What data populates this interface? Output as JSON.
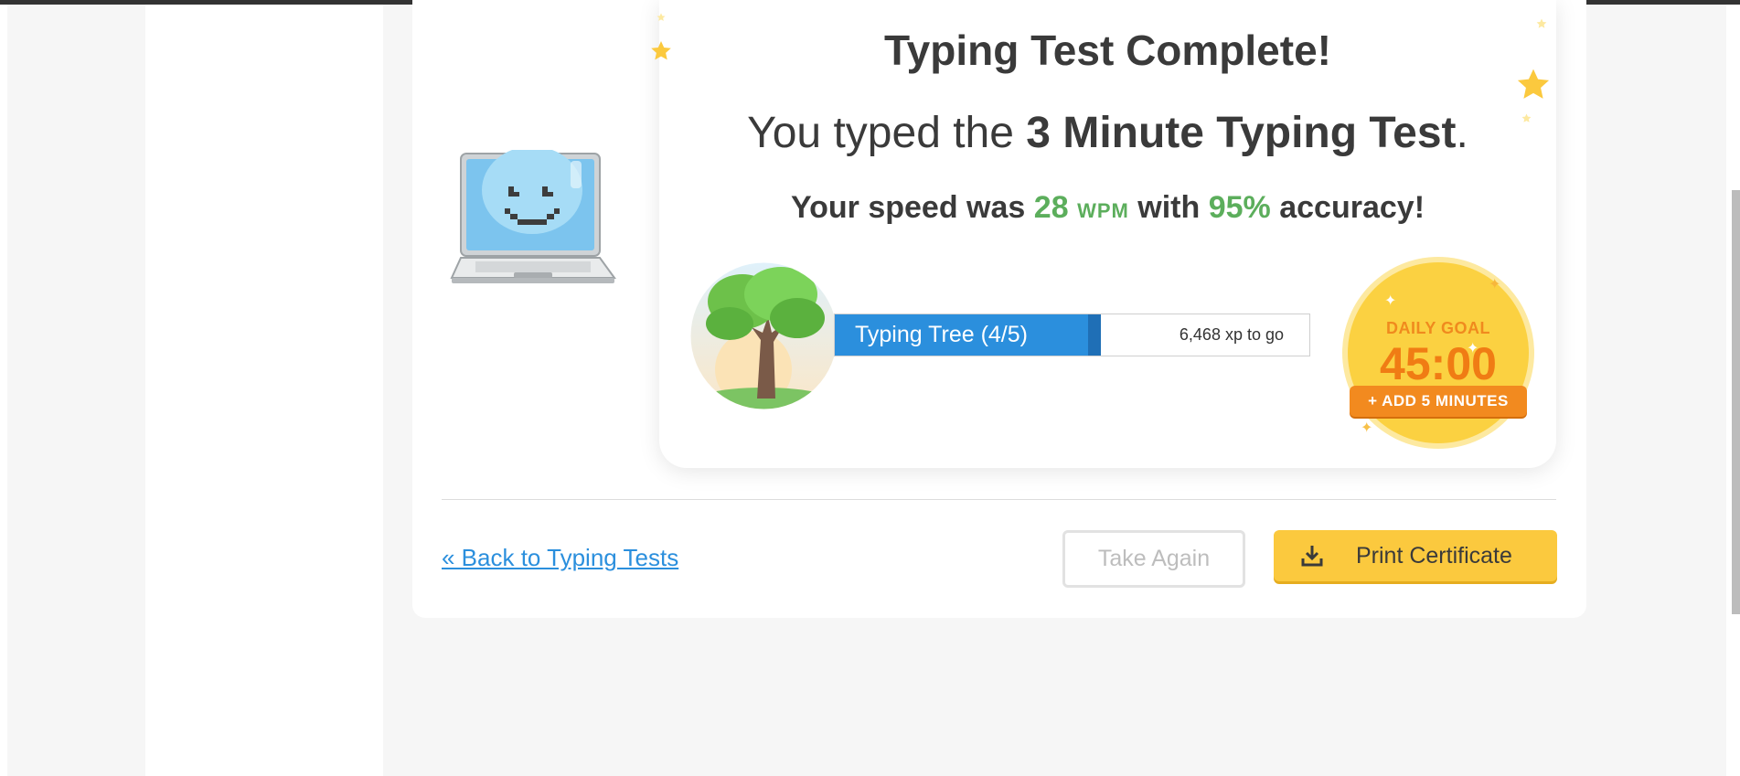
{
  "result": {
    "title": "Typing Test Complete!",
    "subtitle_prefix": "You typed the",
    "subtitle_test": "3 Minute Typing Test",
    "subtitle_suffix": ".",
    "speed_prefix": "Your speed was",
    "wpm_value": "28",
    "wpm_unit": "WPM",
    "speed_mid": "with",
    "accuracy_value": "95%",
    "speed_suffix": "accuracy!"
  },
  "progress": {
    "label": "Typing Tree (4/5)",
    "to_go": "6,468 xp to go",
    "fraction_complete": 0.56
  },
  "daily_goal": {
    "label": "DAILY GOAL",
    "time": "45:00",
    "add_button": "+ ADD 5 MINUTES"
  },
  "footer": {
    "back_link": "« Back to Typing Tests",
    "take_again": "Take Again",
    "print_certificate": "Print Certificate"
  },
  "colors": {
    "accent_green": "#5cae5c",
    "progress_blue": "#2b8fdd",
    "goal_yellow": "#fbd141",
    "goal_orange": "#f28a1f",
    "cert_yellow": "#fbc93e"
  },
  "icons": {
    "mascot": "laptop-smiley-icon",
    "level": "tree-icon",
    "download": "download-icon",
    "decor": "star-icon"
  }
}
